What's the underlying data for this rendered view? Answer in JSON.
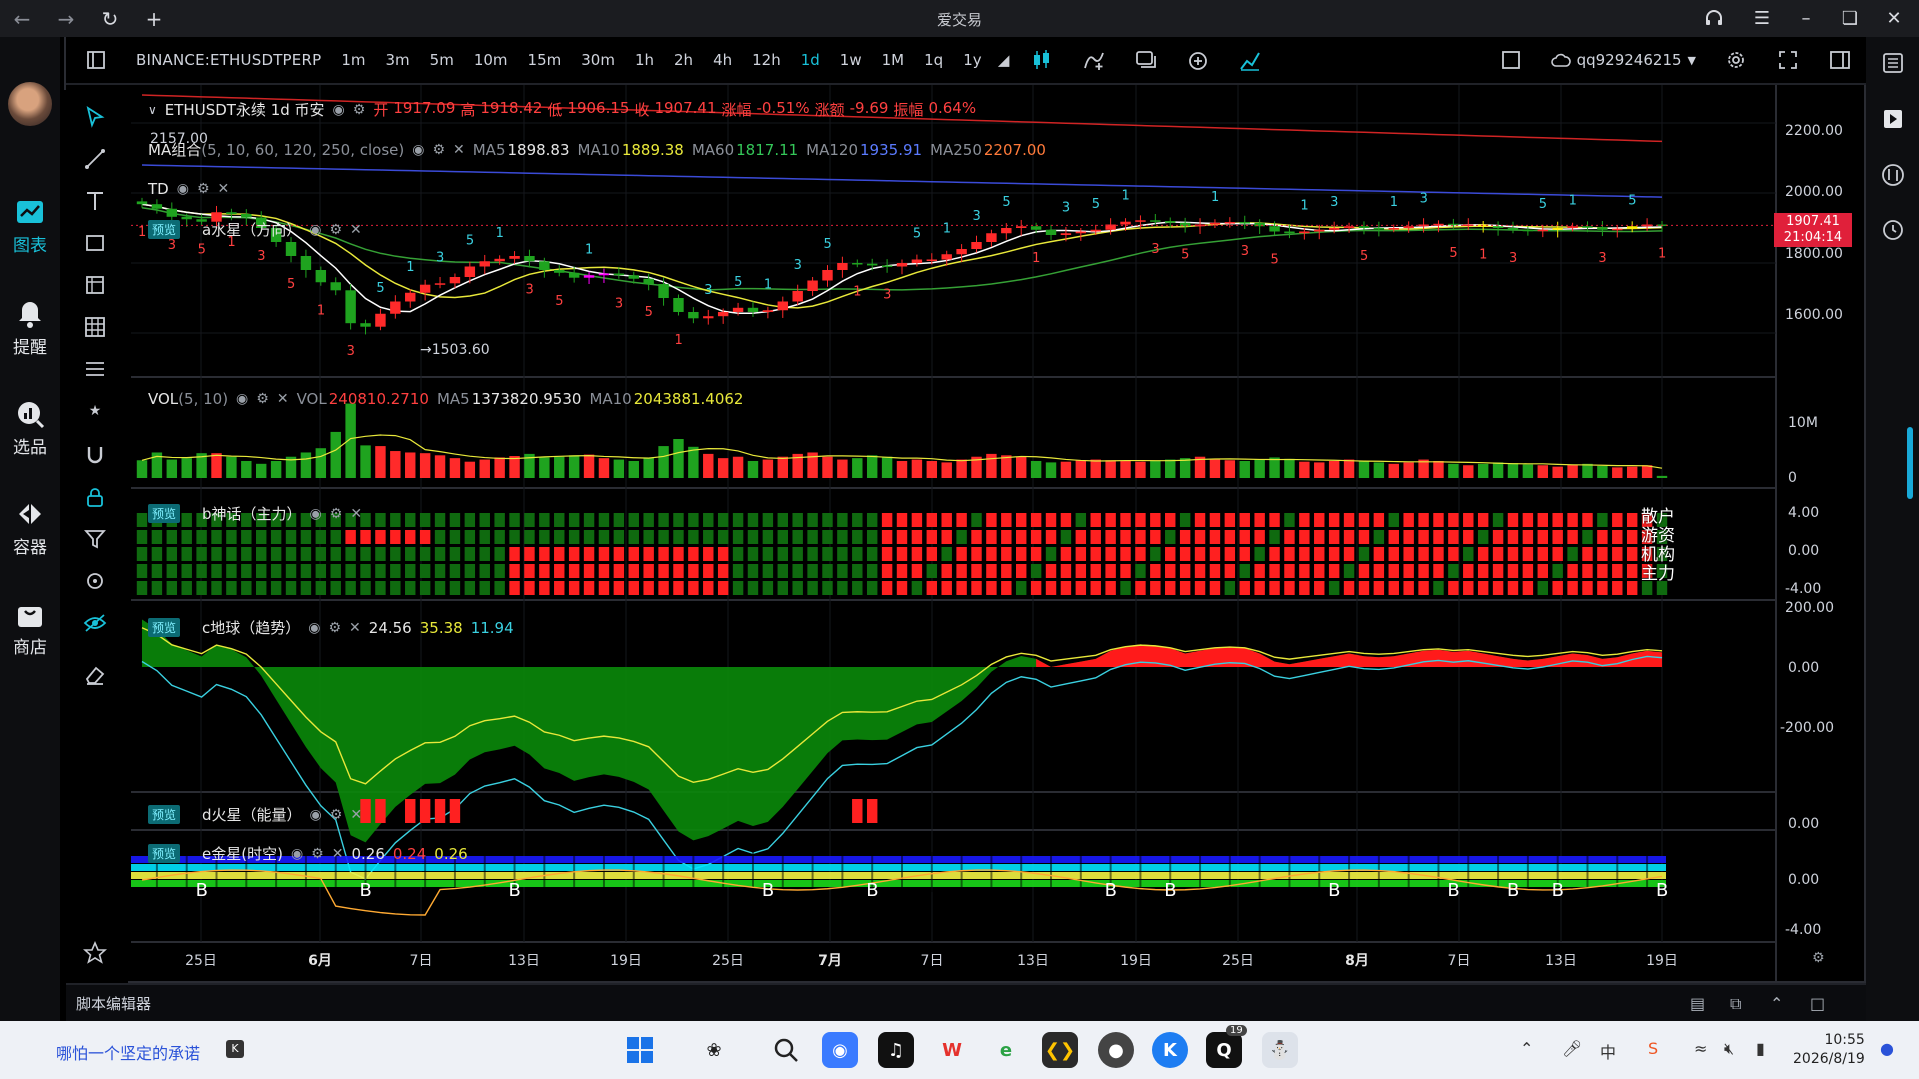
{
  "window": {
    "title": "爱交易",
    "back_icon": "back-arrow-icon",
    "forward_icon": "forward-arrow-icon"
  },
  "app_sidebar": {
    "items": [
      {
        "label": "图表",
        "icon": "chart-icon",
        "active": true
      },
      {
        "label": "提醒",
        "icon": "bell-icon",
        "active": false
      },
      {
        "label": "选品",
        "icon": "magnifier-chart-icon",
        "active": false
      },
      {
        "label": "容器",
        "icon": "code-container-icon",
        "active": false
      },
      {
        "label": "商店",
        "icon": "shopping-bag-icon",
        "active": false
      }
    ]
  },
  "chart_toolbar": {
    "symbol": "BINANCE:ETHUSDTPERP",
    "intervals": [
      "1m",
      "3m",
      "5m",
      "10m",
      "15m",
      "30m",
      "1h",
      "2h",
      "4h",
      "12h",
      "1d",
      "1w",
      "1M",
      "1q",
      "1y"
    ],
    "active_interval": "1d",
    "username": "qq929246215"
  },
  "legends": {
    "main": {
      "title": "ETHUSDT永续 1d 币安",
      "open_label": "开",
      "open": "1917.09",
      "high_label": "高",
      "high": "1918.42",
      "low_label": "低",
      "low": "1906.15",
      "close_label": "收",
      "close": "1907.41",
      "change_pct_label": "涨幅",
      "change_pct": "-0.51%",
      "change_amt_label": "涨额",
      "change_amt": "-9.69",
      "amplitude_label": "振幅",
      "amplitude": "0.64%"
    },
    "ma": {
      "name": "MA组合",
      "params": "(5, 10, 60, 120, 250, close)",
      "ma5_label": "MA5",
      "ma5": "1898.83",
      "ma10_label": "MA10",
      "ma10": "1889.38",
      "ma60_label": "MA60",
      "ma60": "1817.11",
      "ma120_label": "MA120",
      "ma120": "1935.91",
      "ma250_label": "MA250",
      "ma250": "2207.00"
    },
    "td": {
      "name": "TD"
    },
    "a_star": {
      "tag": "预览",
      "name": "a水星（方向）"
    },
    "vol": {
      "name": "VOL",
      "params": "(5, 10)",
      "vol_label": "VOL",
      "vol": "240810.2710",
      "ma5_label": "MA5",
      "ma5": "1373820.9530",
      "ma10_label": "MA10",
      "ma10": "2043881.4062"
    },
    "b_god": {
      "tag": "预览",
      "name": "b神话（主力）"
    },
    "c_earth": {
      "tag": "预览",
      "name": "c地球（趋势）",
      "v1": "24.56",
      "v2": "35.38",
      "v3": "11.94"
    },
    "d_mars": {
      "tag": "预览",
      "name": "d火星（能量）"
    },
    "e_venus": {
      "tag": "预览",
      "name": "e金星(时空)",
      "v1": "0.26",
      "v2": "0.24",
      "v3": "0.26"
    }
  },
  "annotations": {
    "high_marker": "2157.00",
    "low_marker": "1503.60",
    "b_labels": [
      "散户",
      "游资",
      "机构",
      "主力"
    ]
  },
  "price_axis": {
    "main": [
      "2200.00",
      "2000.00",
      "1800.00",
      "1600.00"
    ],
    "vol": [
      "10M",
      "0"
    ],
    "b": [
      "4.00",
      "0.00",
      "-4.00"
    ],
    "c": [
      "200.00",
      "0.00",
      "-200.00"
    ],
    "d": [
      "0.00"
    ],
    "e": [
      "0.00",
      "-4.00"
    ],
    "current_price": "1907.41",
    "countdown": "21:04:14"
  },
  "date_axis": {
    "labels": [
      {
        "text": "25日",
        "bold": false
      },
      {
        "text": "6月",
        "bold": true
      },
      {
        "text": "7日",
        "bold": false
      },
      {
        "text": "13日",
        "bold": false
      },
      {
        "text": "19日",
        "bold": false
      },
      {
        "text": "25日",
        "bold": false
      },
      {
        "text": "7月",
        "bold": true
      },
      {
        "text": "7日",
        "bold": false
      },
      {
        "text": "13日",
        "bold": false
      },
      {
        "text": "19日",
        "bold": false
      },
      {
        "text": "25日",
        "bold": false
      },
      {
        "text": "8月",
        "bold": true
      },
      {
        "text": "7日",
        "bold": false
      },
      {
        "text": "13日",
        "bold": false
      },
      {
        "text": "19日",
        "bold": false
      }
    ]
  },
  "script_editor": {
    "label": "脚本编辑器"
  },
  "taskbar": {
    "status_message": "哪怕一个坚定的承诺",
    "time": "10:55",
    "date": "2026/8/19",
    "badge": "19"
  },
  "colors": {
    "up": "#ff2a2a",
    "down": "#1fa31f",
    "accent": "#19c1d9",
    "ma5": "#ffffff",
    "ma10": "#e8e83a",
    "ma60": "#35a035",
    "ma120": "#3b4bd8",
    "ma250": "#d02424"
  },
  "chart_data": {
    "type": "candlestick",
    "dates_start_label": "25日",
    "close_series": [
      1968,
      1955,
      1932,
      1925,
      1918,
      1945,
      1940,
      1930,
      1900,
      1860,
      1820,
      1780,
      1745,
      1722,
      1628,
      1618,
      1655,
      1690,
      1715,
      1738,
      1742,
      1760,
      1790,
      1805,
      1812,
      1820,
      1805,
      1780,
      1772,
      1758,
      1765,
      1770,
      1765,
      1755,
      1740,
      1700,
      1660,
      1642,
      1648,
      1660,
      1672,
      1660,
      1665,
      1690,
      1720,
      1750,
      1780,
      1800,
      1798,
      1793,
      1790,
      1800,
      1810,
      1810,
      1825,
      1840,
      1860,
      1885,
      1900,
      1905,
      1895,
      1880,
      1885,
      1890,
      1895,
      1910,
      1918,
      1922,
      1920,
      1915,
      1905,
      1910,
      1915,
      1917,
      1915,
      1905,
      1890,
      1885,
      1890,
      1895,
      1900,
      1905,
      1900,
      1898,
      1900,
      1905,
      1910,
      1912,
      1908,
      1910,
      1905,
      1900,
      1895,
      1892,
      1895,
      1900,
      1905,
      1902,
      1895,
      1898,
      1905,
      1910,
      1907
    ],
    "volume_series_m": [
      2.5,
      3.6,
      2.6,
      2.8,
      3.5,
      3.5,
      3.0,
      2.4,
      2.0,
      2.4,
      3.0,
      3.6,
      4.2,
      6.5,
      10.5,
      4.6,
      4.5,
      3.8,
      3.6,
      3.5,
      3.2,
      2.8,
      2.3,
      2.6,
      2.9,
      3.1,
      3.4,
      2.9,
      3.0,
      3.2,
      3.3,
      2.8,
      2.6,
      2.4,
      2.9,
      4.5,
      5.5,
      4.4,
      3.4,
      2.8,
      3.0,
      2.4,
      2.6,
      3.0,
      3.4,
      3.6,
      3.0,
      2.6,
      2.8,
      3.2,
      3.0,
      2.4,
      2.6,
      2.4,
      2.2,
      2.6,
      3.0,
      3.4,
      3.2,
      3.0,
      2.4,
      2.2,
      2.3,
      2.5,
      2.6,
      2.5,
      2.4,
      2.3,
      2.4,
      2.6,
      2.8,
      3.0,
      2.6,
      2.5,
      2.4,
      2.6,
      2.9,
      2.7,
      2.3,
      2.2,
      2.4,
      2.6,
      2.4,
      2.2,
      2.0,
      2.2,
      2.6,
      2.4,
      2.0,
      1.8,
      2.0,
      2.2,
      2.1,
      1.9,
      1.8,
      1.6,
      1.9,
      2.0,
      1.7,
      1.5,
      1.6,
      1.8,
      0.3
    ],
    "ylim": [
      1480,
      2280
    ]
  }
}
